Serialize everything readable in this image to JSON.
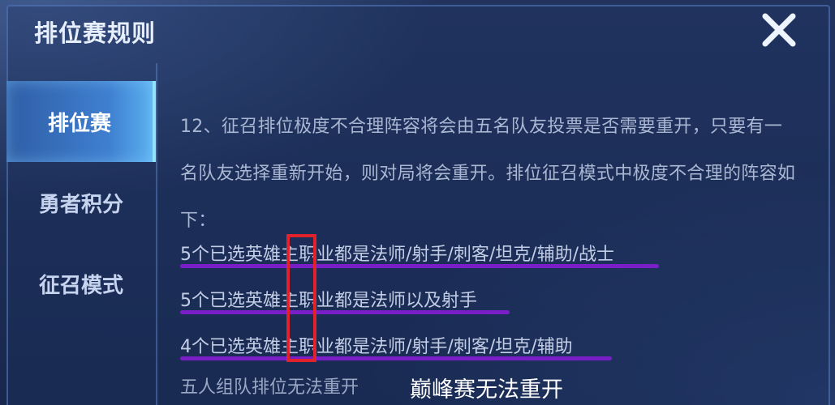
{
  "header": {
    "title": "排位赛规则"
  },
  "close": {
    "icon": "close-icon"
  },
  "sidebar": {
    "items": [
      {
        "label": "排位赛",
        "active": true
      },
      {
        "label": "勇者积分",
        "active": false
      },
      {
        "label": "征召模式",
        "active": false
      }
    ]
  },
  "content": {
    "paragraph": "12、征召排位极度不合理阵容将会由五名队友投票是否需要重开，只要有一名队友选择重新开始，则对局将会重开。排位征召模式中极度不合理的阵容如下：",
    "lines": [
      "5个已选英雄主职业都是法师/射手/刺客/坦克/辅助/战士",
      "5个已选英雄主职业都是法师以及射手",
      "4个已选英雄主职业都是法师/射手/刺客/坦克/辅助"
    ],
    "footer_left": "五人组队排位无法重开",
    "footer_right": "巅峰赛无法重开"
  },
  "colors": {
    "accent": "#3f7fd0",
    "underline": "#7a1fc7",
    "highlight": "#e0222a"
  }
}
